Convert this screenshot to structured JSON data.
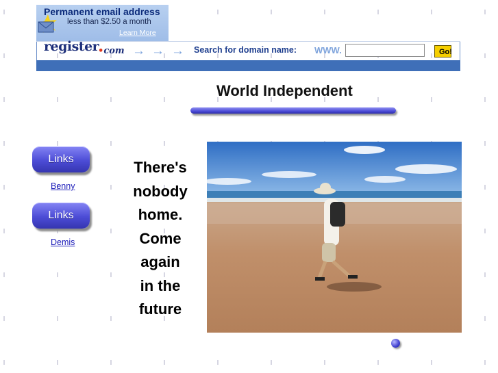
{
  "banner": {
    "promo_title": "Permanent email address",
    "promo_sub": "less than $2.50 a month",
    "promo_more": "Learn More",
    "logo_text": "register",
    "logo_com": "com",
    "search_label": "Search for domain name:",
    "www_label": "WWW.",
    "domain_value": "",
    "go_label": "Go!"
  },
  "page": {
    "title": "World Independent"
  },
  "nav": {
    "items": [
      {
        "button_label": "Links",
        "link_label": "Benny"
      },
      {
        "button_label": "Links",
        "link_label": "Demis"
      }
    ]
  },
  "message": {
    "lines": [
      "There's",
      "nobody",
      "home.",
      "Come",
      "again",
      "in the",
      "future"
    ]
  },
  "colors": {
    "accent": "#4c4cd6",
    "banner_bar": "#3f6fb8",
    "go_button": "#f6cf00",
    "link": "#2222bb"
  }
}
